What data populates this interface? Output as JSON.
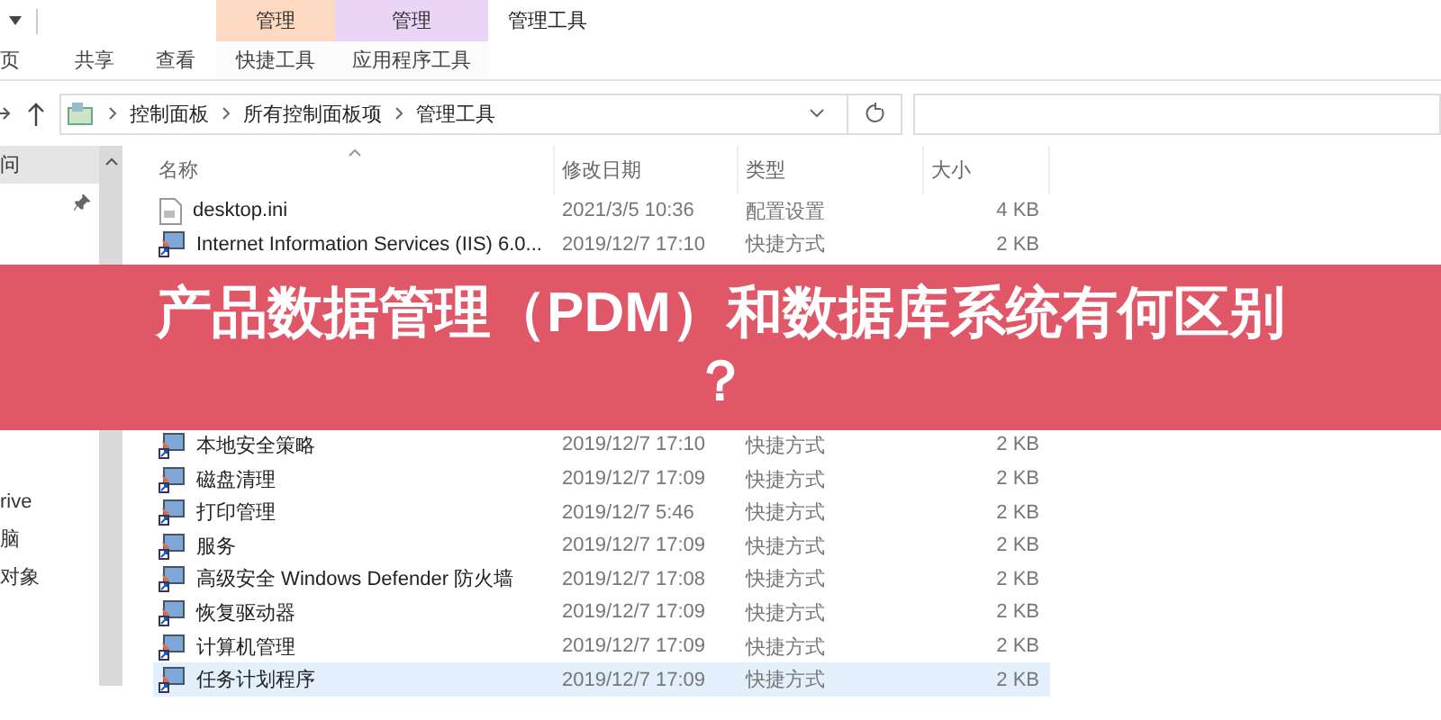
{
  "window": {
    "title": "管理工具"
  },
  "ribbon": {
    "tabs": [
      {
        "label": "页"
      },
      {
        "label": "共享"
      },
      {
        "label": "查看"
      }
    ],
    "context_tabs": [
      {
        "group": "管理",
        "label": "快捷工具",
        "color": "#fcd9c0"
      },
      {
        "group": "管理",
        "label": "应用程序工具",
        "color": "#ead5f7"
      }
    ]
  },
  "address_bar": {
    "path": [
      "控制面板",
      "所有控制面板项",
      "管理工具"
    ]
  },
  "sidebar": {
    "items_top": [
      {
        "label": "问",
        "pinned": false,
        "selected": true
      },
      {
        "pinned": true,
        "selected": false
      }
    ],
    "items_bottom": [
      {
        "label": "rive",
        "pinned": false,
        "selected": false
      },
      {
        "label": "脑",
        "pinned": false,
        "selected": false
      },
      {
        "label": "对象",
        "pinned": false,
        "selected": false
      }
    ]
  },
  "table": {
    "columns": [
      "名称",
      "修改日期",
      "类型",
      "大小"
    ],
    "rows_above": [
      {
        "name": "desktop.ini",
        "date": "2021/3/5 10:36",
        "type": "配置设置",
        "size": "4 KB",
        "kind": "file",
        "selected": false
      },
      {
        "name": "Internet Information Services (IIS) 6.0...",
        "date": "2019/12/7 17:10",
        "type": "快捷方式",
        "size": "2 KB",
        "kind": "shortcut",
        "selected": false
      }
    ],
    "rows_below": [
      {
        "name": "本地安全策略",
        "date": "2019/12/7 17:10",
        "type": "快捷方式",
        "size": "2 KB",
        "kind": "shortcut",
        "selected": false
      },
      {
        "name": "磁盘清理",
        "date": "2019/12/7 17:09",
        "type": "快捷方式",
        "size": "2 KB",
        "kind": "shortcut",
        "selected": false
      },
      {
        "name": "打印管理",
        "date": "2019/12/7 5:46",
        "type": "快捷方式",
        "size": "2 KB",
        "kind": "shortcut",
        "selected": false
      },
      {
        "name": "服务",
        "date": "2019/12/7 17:09",
        "type": "快捷方式",
        "size": "2 KB",
        "kind": "shortcut",
        "selected": false
      },
      {
        "name": "高级安全 Windows Defender 防火墙",
        "date": "2019/12/7 17:08",
        "type": "快捷方式",
        "size": "2 KB",
        "kind": "shortcut",
        "selected": false
      },
      {
        "name": "恢复驱动器",
        "date": "2019/12/7 17:09",
        "type": "快捷方式",
        "size": "2 KB",
        "kind": "shortcut",
        "selected": false
      },
      {
        "name": "计算机管理",
        "date": "2019/12/7 17:09",
        "type": "快捷方式",
        "size": "2 KB",
        "kind": "shortcut",
        "selected": false
      },
      {
        "name": "任务计划程序",
        "date": "2019/12/7 17:09",
        "type": "快捷方式",
        "size": "2 KB",
        "kind": "shortcut",
        "selected": true
      }
    ]
  },
  "banner": {
    "lines": [
      "产品数据管理（PDM）和数据库系统有何区别",
      "？"
    ]
  }
}
